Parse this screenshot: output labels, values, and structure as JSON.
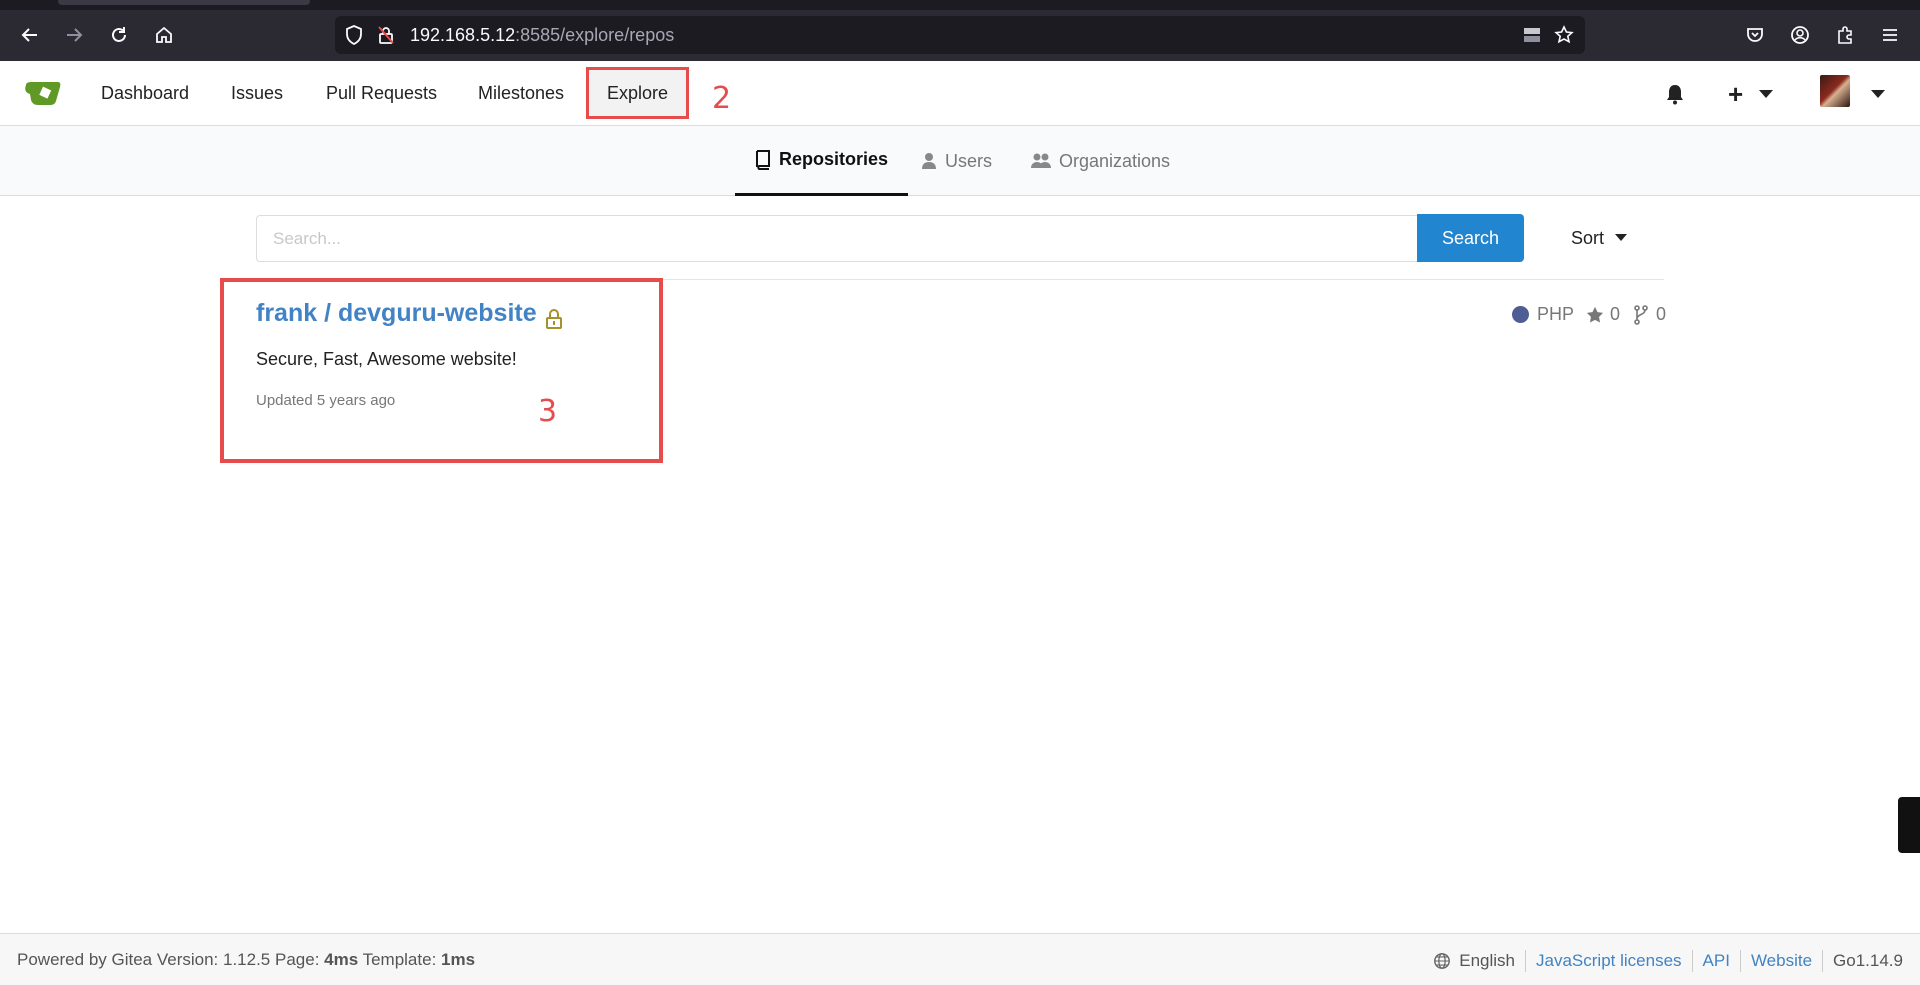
{
  "browser": {
    "url_host": "192.168.5.12",
    "url_rest": ":8585/explore/repos"
  },
  "header": {
    "nav": [
      "Dashboard",
      "Issues",
      "Pull Requests",
      "Milestones"
    ],
    "explore_label": "Explore",
    "annotation_explore": "2"
  },
  "submenu": {
    "repositories": "Repositories",
    "users": "Users",
    "organizations": "Organizations"
  },
  "search": {
    "placeholder": "Search...",
    "button_label": "Search",
    "sort_label": "Sort"
  },
  "repo": {
    "title": "frank / devguru-website",
    "description": "Secure, Fast, Awesome website!",
    "updated_prefix": "Updated ",
    "updated_value": "5 years ago",
    "language": "PHP",
    "language_color": "#4F5D95",
    "stars": "0",
    "forks": "0",
    "annotation": "3"
  },
  "footer": {
    "powered_by": "Powered by Gitea Version: 1.12.5 Page: ",
    "page_time": "4ms",
    "template_label": " Template: ",
    "template_time": "1ms",
    "language": "English",
    "js_licenses": "JavaScript licenses",
    "api": "API",
    "website": "Website",
    "go_version": "Go1.14.9"
  },
  "colors": {
    "accent": "#2185d0",
    "link": "#4183c4",
    "annotation": "#e64c4c"
  }
}
